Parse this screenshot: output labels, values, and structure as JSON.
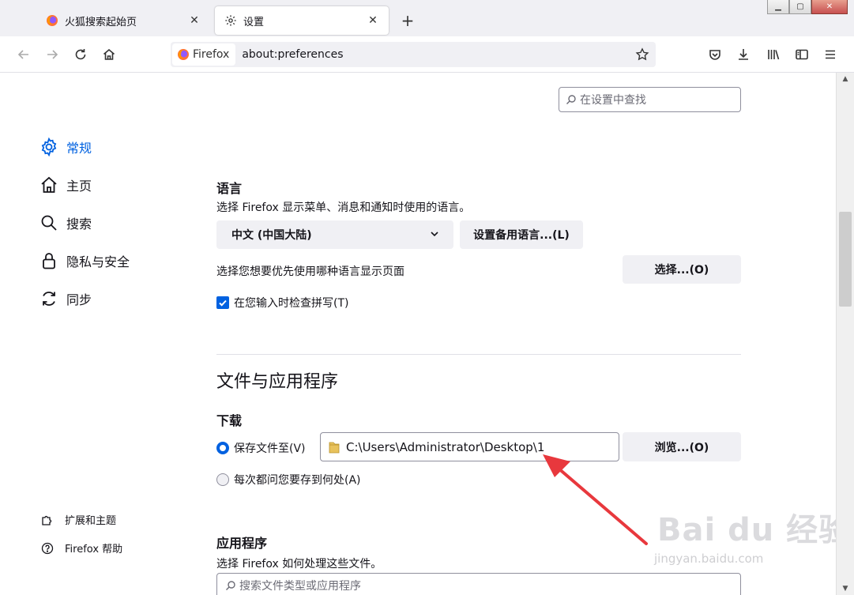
{
  "tabs": [
    {
      "label": "火狐搜索起始页",
      "icon": "firefox-logo-icon",
      "active": false
    },
    {
      "label": "设置",
      "icon": "gear-icon",
      "active": true
    }
  ],
  "urlbar": {
    "identity": "Firefox",
    "url": "about:preferences"
  },
  "search": {
    "placeholder": "在设置中查找"
  },
  "sidebar": {
    "categories": [
      {
        "label": "常规",
        "icon": "gear-icon",
        "selected": true
      },
      {
        "label": "主页",
        "icon": "home-icon"
      },
      {
        "label": "搜索",
        "icon": "search-icon"
      },
      {
        "label": "隐私与安全",
        "icon": "lock-icon"
      },
      {
        "label": "同步",
        "icon": "sync-icon"
      }
    ],
    "footer": [
      {
        "label": "扩展和主题",
        "icon": "puzzle-icon"
      },
      {
        "label": "Firefox 帮助",
        "icon": "help-icon"
      }
    ]
  },
  "language": {
    "heading": "语言",
    "description": "选择 Firefox 显示菜单、消息和通知时使用的语言。",
    "selected": "中文 (中国大陆)",
    "alternatives_button": "设置备用语言...(L)",
    "page_lang_label": "选择您想要优先使用哪种语言显示页面",
    "choose_button": "选择...(O)",
    "spellcheck_label": "在您输入时检查拼写(T)",
    "spellcheck_checked": true
  },
  "files": {
    "heading": "文件与应用程序",
    "downloads_heading": "下载",
    "save_to_label": "保存文件至(V)",
    "path": "C:\\Users\\Administrator\\Desktop\\1",
    "browse_button": "浏览...(O)",
    "ask_label": "每次都问您要存到何处(A)",
    "save_to_selected": true
  },
  "applications": {
    "heading": "应用程序",
    "description": "选择 Firefox 如何处理这些文件。",
    "search_placeholder": "搜索文件类型或应用程序"
  },
  "watermark": {
    "text": "Bai du 经验",
    "url": "jingyan.baidu.com"
  },
  "colors": {
    "accent": "#0061e0",
    "arrow": "#e8383d"
  }
}
